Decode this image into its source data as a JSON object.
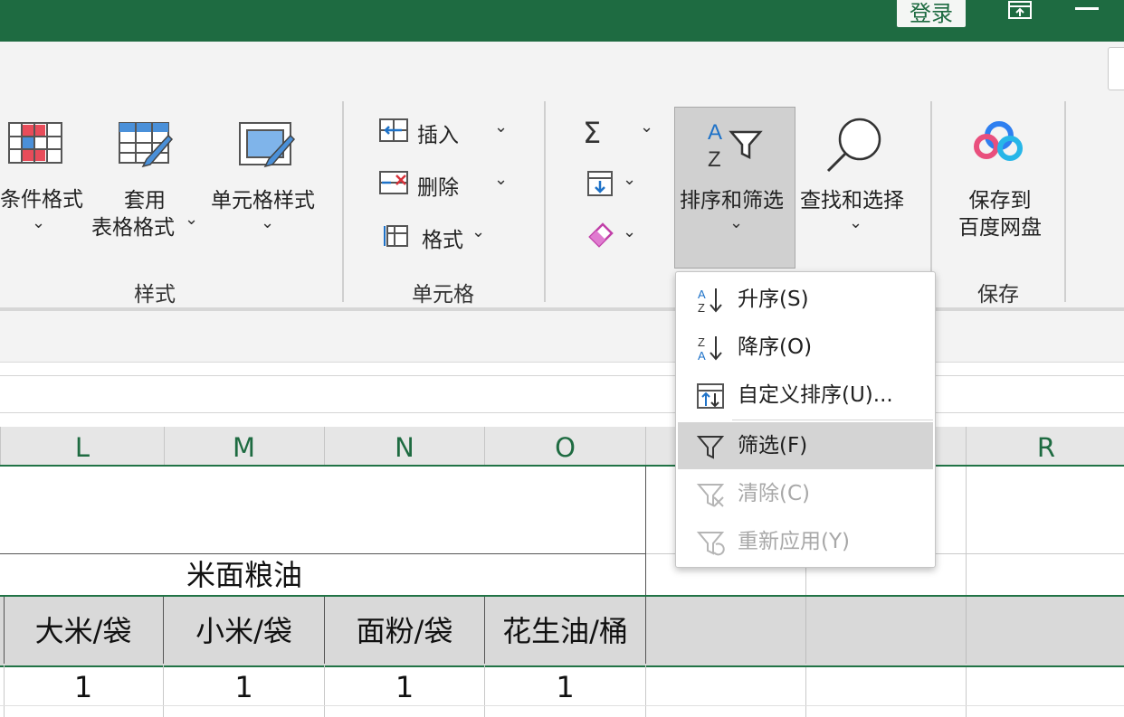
{
  "titlebar": {
    "login_label": "登录"
  },
  "ribbon": {
    "styles": {
      "conditional_format": "条件格式",
      "table_format_line1": "套用",
      "table_format_line2": "表格格式",
      "cell_style": "单元格样式",
      "group_label": "样式"
    },
    "cells": {
      "insert": "插入",
      "delete": "删除",
      "format": "格式",
      "group_label": "单元格"
    },
    "editing": {
      "sort_filter": "排序和筛选",
      "find_select": "查找和选择"
    },
    "save": {
      "save_line1": "保存到",
      "save_line2": "百度网盘",
      "group_label": "保存"
    }
  },
  "sort_menu": {
    "items": [
      {
        "label": "升序(S)",
        "icon": "sort-ascending-icon",
        "enabled": true
      },
      {
        "label": "降序(O)",
        "icon": "sort-descending-icon",
        "enabled": true
      },
      {
        "label": "自定义排序(U)...",
        "icon": "custom-sort-icon",
        "enabled": true
      },
      {
        "label": "筛选(F)",
        "icon": "filter-icon",
        "enabled": true,
        "highlighted": true
      },
      {
        "label": "清除(C)",
        "icon": "clear-filter-icon",
        "enabled": false
      },
      {
        "label": "重新应用(Y)",
        "icon": "reapply-filter-icon",
        "enabled": false
      }
    ]
  },
  "grid": {
    "columns": [
      "L",
      "M",
      "N",
      "O",
      "",
      "",
      "R"
    ],
    "merged_header": "米面粮油",
    "headers": [
      "大米/袋",
      "小米/袋",
      "面粉/袋",
      "花生油/桶"
    ],
    "row_values": [
      "1",
      "1",
      "1",
      "1"
    ]
  },
  "colors": {
    "accent": "#1e6b41",
    "menu_highlight": "#d4d4d4",
    "disabled_text": "#a8a8a8"
  }
}
